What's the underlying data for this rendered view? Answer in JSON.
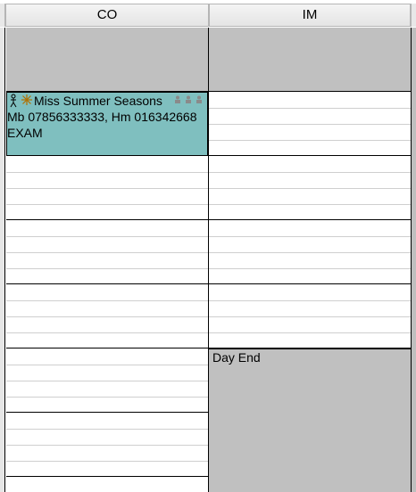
{
  "columns": [
    {
      "label": "CO"
    },
    {
      "label": "IM"
    }
  ],
  "appointment": {
    "name": "Miss Summer Seasons",
    "phones": "Mb 07856333333, Hm 016342668",
    "type": "EXAM",
    "icons": [
      "patient-figure-icon",
      "star-icon"
    ],
    "status_icons": [
      "status-person-icon",
      "status-person-icon",
      "status-person-icon"
    ],
    "colors": {
      "background": "#7fbfbf"
    }
  },
  "day_end_label": "Day End",
  "colors": {
    "closed": "#c0c0c0",
    "grid_minor": "#cfcfcf",
    "grid_hour": "#000000"
  }
}
